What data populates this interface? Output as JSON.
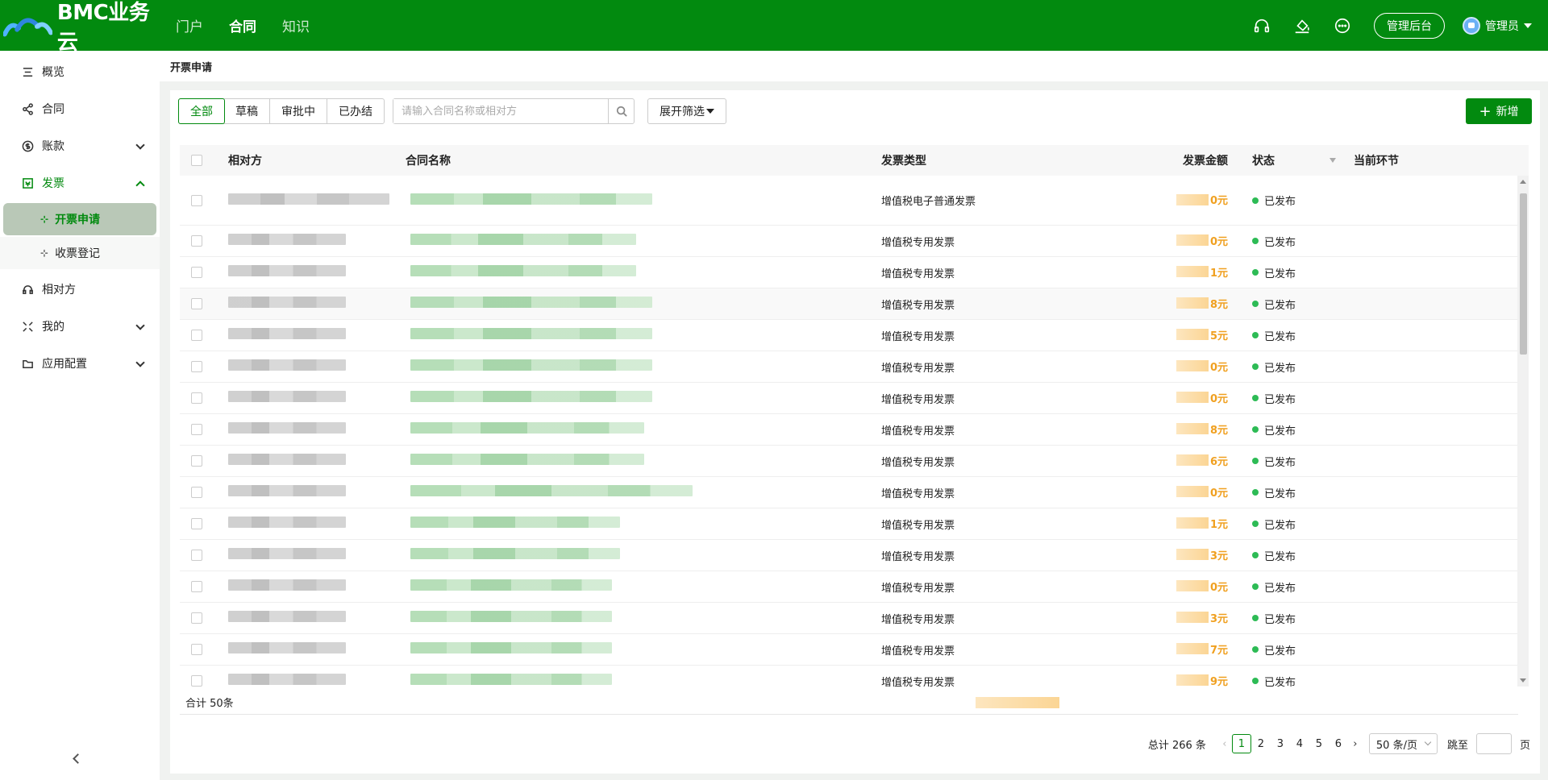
{
  "header": {
    "brand": "BMC业务云",
    "nav": [
      {
        "label": "门户",
        "active": false
      },
      {
        "label": "合同",
        "active": true
      },
      {
        "label": "知识",
        "active": false
      }
    ],
    "icons": [
      "headset-icon",
      "paint-bucket-icon",
      "chat-icon"
    ],
    "admin_button": "管理后台",
    "user_name": "管理员",
    "brand_color": "#028a0f"
  },
  "sidebar": {
    "items": [
      {
        "label": "概览",
        "icon": "overview-icon"
      },
      {
        "label": "合同",
        "icon": "share-icon"
      },
      {
        "label": "账款",
        "icon": "money-icon"
      },
      {
        "label": "发票",
        "icon": "invoice-icon"
      },
      {
        "label": "相对方",
        "icon": "headset-icon"
      },
      {
        "label": "我的",
        "icon": "expand-icon"
      },
      {
        "label": "应用配置",
        "icon": "folder-icon"
      }
    ],
    "sub_items": [
      {
        "label": "开票申请",
        "active": true
      },
      {
        "label": "收票登记",
        "active": false
      }
    ]
  },
  "breadcrumb": "开票申请",
  "toolbar": {
    "tabs": [
      {
        "label": "全部",
        "active": true
      },
      {
        "label": "草稿",
        "active": false
      },
      {
        "label": "审批中",
        "active": false
      },
      {
        "label": "已办结",
        "active": false
      }
    ],
    "search_placeholder": "请输入合同名称或相对方",
    "filter_label": "展开筛选",
    "add_label": "新增"
  },
  "table": {
    "columns": [
      "相对方",
      "合同名称",
      "发票类型",
      "发票金额",
      "状态",
      "当前环节"
    ],
    "rows": [
      {
        "type": "增值税电子普通发票",
        "amount": "0元",
        "status": "已发布"
      },
      {
        "type": "增值税专用发票",
        "amount": "0元",
        "status": "已发布"
      },
      {
        "type": "增值税专用发票",
        "amount": "1元",
        "status": "已发布"
      },
      {
        "type": "增值税专用发票",
        "amount": "8元",
        "status": "已发布"
      },
      {
        "type": "增值税专用发票",
        "amount": "5元",
        "status": "已发布"
      },
      {
        "type": "增值税专用发票",
        "amount": "0元",
        "status": "已发布"
      },
      {
        "type": "增值税专用发票",
        "amount": "0元",
        "status": "已发布"
      },
      {
        "type": "增值税专用发票",
        "amount": "8元",
        "status": "已发布"
      },
      {
        "type": "增值税专用发票",
        "amount": "6元",
        "status": "已发布"
      },
      {
        "type": "增值税专用发票",
        "amount": "0元",
        "status": "已发布"
      },
      {
        "type": "增值税专用发票",
        "amount": "1元",
        "status": "已发布"
      },
      {
        "type": "增值税专用发票",
        "amount": "3元",
        "status": "已发布"
      },
      {
        "type": "增值税专用发票",
        "amount": "0元",
        "status": "已发布"
      },
      {
        "type": "增值税专用发票",
        "amount": "3元",
        "status": "已发布"
      },
      {
        "type": "增值税专用发票",
        "amount": "7元",
        "status": "已发布"
      },
      {
        "type": "增值税专用发票",
        "amount": "9元",
        "status": "已发布"
      }
    ],
    "status_color": "#2dbb55",
    "amount_color": "#f0a020"
  },
  "summary": "合计 50条",
  "pagination": {
    "total": "总计 266 条",
    "pages": [
      "1",
      "2",
      "3",
      "4",
      "5",
      "6"
    ],
    "current": "1",
    "page_size": "50 条/页",
    "jump_label": "跳至",
    "page_suffix": "页"
  }
}
